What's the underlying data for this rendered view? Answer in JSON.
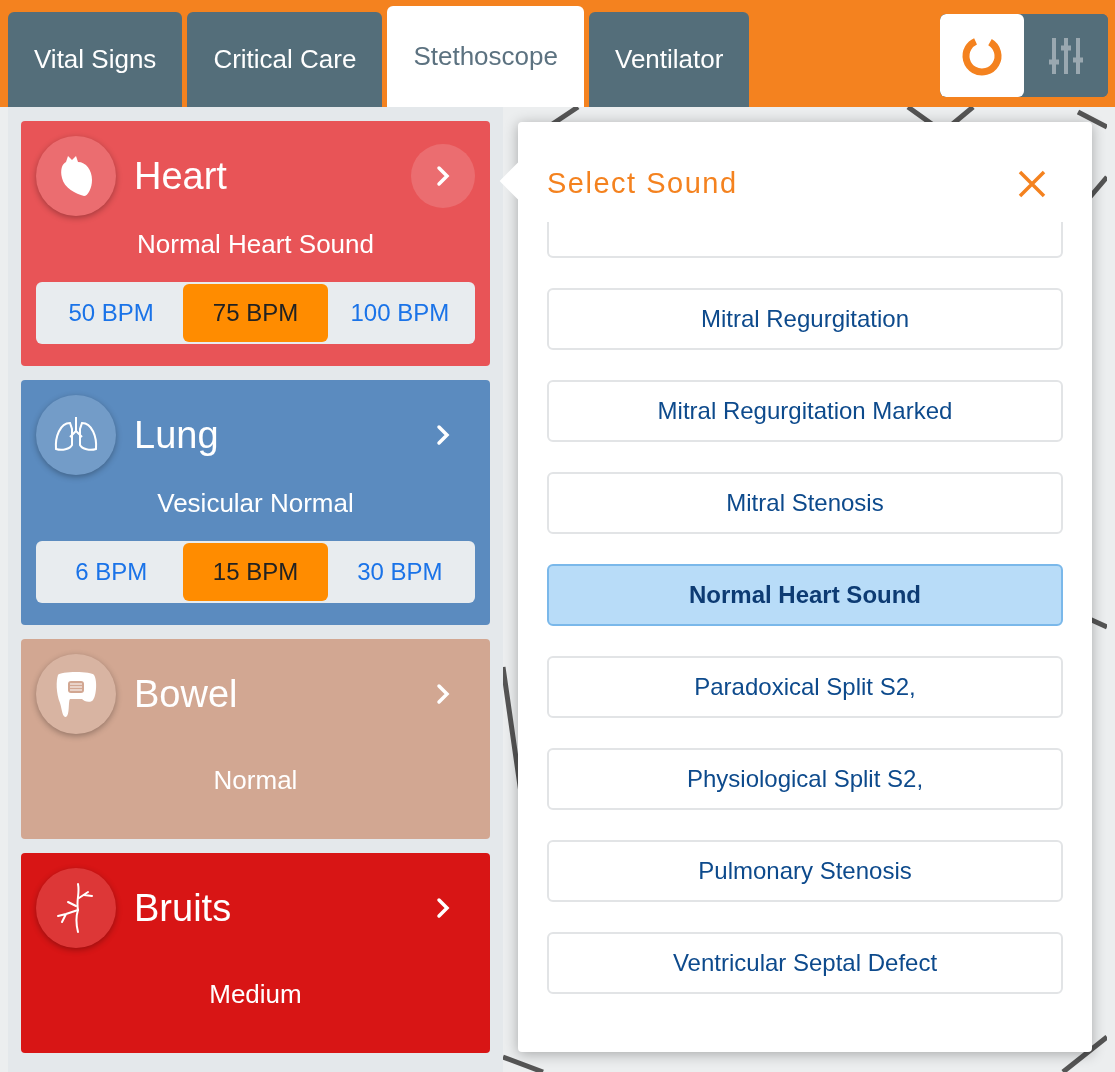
{
  "tabs": [
    {
      "label": "Vital Signs",
      "selected": false
    },
    {
      "label": "Critical Care",
      "selected": false
    },
    {
      "label": "Stethoscope",
      "selected": true
    },
    {
      "label": "Ventilator",
      "selected": false
    }
  ],
  "view_toggle": [
    {
      "kind": "donut",
      "selected": true
    },
    {
      "kind": "sliders",
      "selected": false
    }
  ],
  "cards": [
    {
      "kind": "heart",
      "title": "Heart",
      "subtitle": "Normal Heart Sound",
      "color": "#e85457",
      "expanded": true,
      "rates": [
        {
          "label": "50 BPM",
          "selected": false
        },
        {
          "label": "75 BPM",
          "selected": true
        },
        {
          "label": "100 BPM",
          "selected": false
        }
      ]
    },
    {
      "kind": "lung",
      "title": "Lung",
      "subtitle": "Vesicular Normal",
      "color": "#5b8bbf",
      "expanded": false,
      "rates": [
        {
          "label": "6 BPM",
          "selected": false
        },
        {
          "label": "15 BPM",
          "selected": true
        },
        {
          "label": "30 BPM",
          "selected": false
        }
      ]
    },
    {
      "kind": "bowel",
      "title": "Bowel",
      "subtitle": "Normal",
      "color": "#d2a792",
      "expanded": false
    },
    {
      "kind": "bruits",
      "title": "Bruits",
      "subtitle": "Medium",
      "color": "#d81515",
      "expanded": false
    }
  ],
  "popover": {
    "title": "Select Sound",
    "more_above": true,
    "options": [
      {
        "label": "Mitral Regurgitation",
        "selected": false
      },
      {
        "label": "Mitral Regurgitation Marked",
        "selected": false
      },
      {
        "label": "Mitral Stenosis",
        "selected": false
      },
      {
        "label": "Normal Heart Sound",
        "selected": true
      },
      {
        "label": "Paradoxical Split S2,",
        "selected": false
      },
      {
        "label": "Physiological Split S2,",
        "selected": false
      },
      {
        "label": "Pulmonary Stenosis",
        "selected": false
      },
      {
        "label": "Ventricular Septal Defect",
        "selected": false
      }
    ]
  }
}
